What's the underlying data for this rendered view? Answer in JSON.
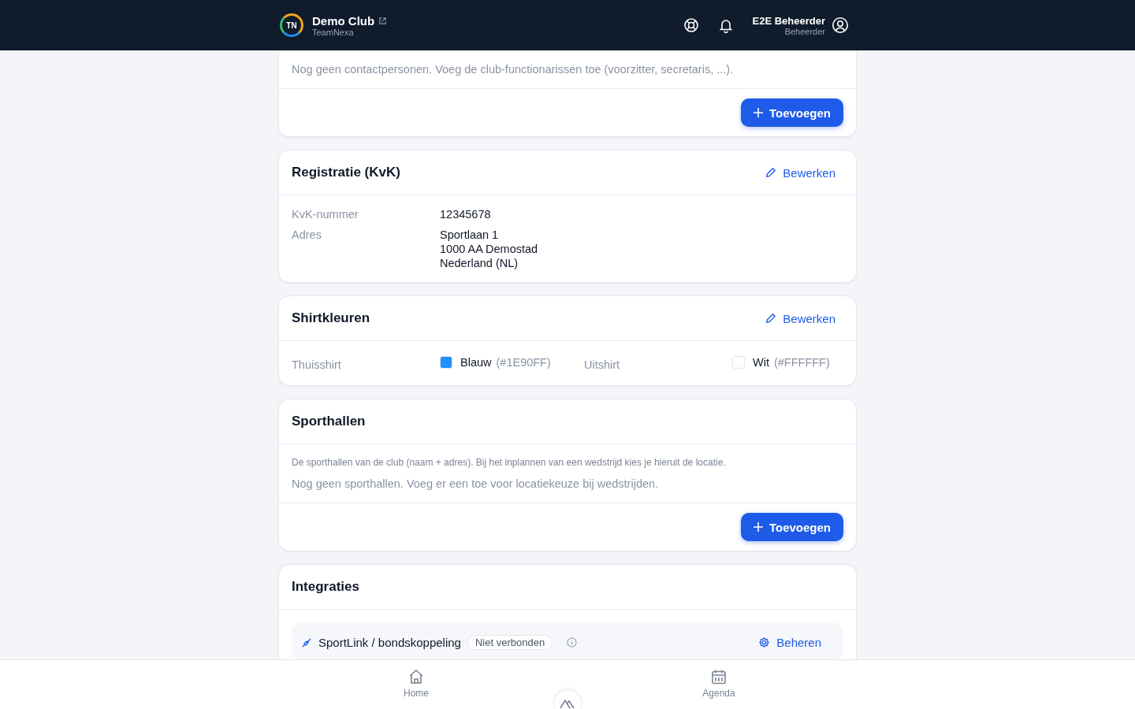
{
  "header": {
    "club_name": "Demo Club",
    "app_name": "TeamNexa",
    "logo_text": "TN",
    "user_name": "E2E Beheerder",
    "user_role": "Beheerder"
  },
  "contacts_card": {
    "empty_text": "Nog geen contactpersonen. Voeg de club-functionarissen toe (voorzitter, secretaris, ...).",
    "add_button": "Toevoegen"
  },
  "registration_card": {
    "title": "Registratie (KvK)",
    "edit_button": "Bewerken",
    "fields": [
      {
        "label": "KvK-nummer",
        "lines": [
          "12345678"
        ]
      },
      {
        "label": "Adres",
        "lines": [
          "Sportlaan 1",
          "1000 AA Demostad",
          "Nederland (NL)"
        ]
      }
    ]
  },
  "shirt_card": {
    "title": "Shirtkleuren",
    "edit_button": "Bewerken",
    "shirts": [
      {
        "label": "Thuisshirt",
        "color_name": "Blauw",
        "color_code": "(#1E90FF)",
        "color": "#1e90ff"
      },
      {
        "label": "Uitshirt",
        "color_name": "Wit",
        "color_code": "(#FFFFFF)",
        "color": "#ffffff"
      }
    ]
  },
  "halls_card": {
    "title": "Sporthallen",
    "description": "De sporthallen van de club (naam + adres). Bij het inplannen van een wedstrijd kies je hieruit de locatie.",
    "empty_text": "Nog geen sporthallen. Voeg er een toe voor locatiekeuze bij wedstrijden.",
    "add_button": "Toevoegen"
  },
  "integrations_card": {
    "title": "Integraties",
    "items": [
      {
        "name": "SportLink / bondskoppeling",
        "status": "Niet verbonden",
        "connected": false,
        "manage_button": "Beheren"
      }
    ]
  },
  "bottom_nav": [
    {
      "label": "Home",
      "kind": "home",
      "selected": false
    },
    {
      "label": "Agenda",
      "kind": "calendar",
      "selected": false
    }
  ]
}
